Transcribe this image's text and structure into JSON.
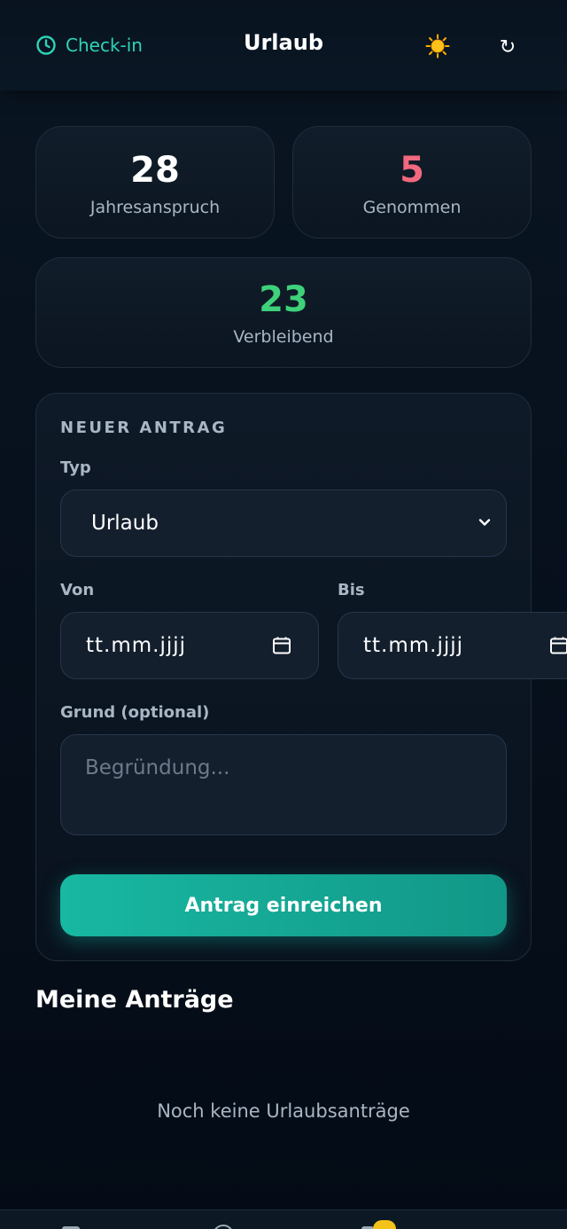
{
  "header": {
    "checkin_label": "Check-in",
    "title": "Urlaub",
    "theme_icon": "sun-icon",
    "refresh_icon": "refresh-icon",
    "refresh_glyph": "↻"
  },
  "stats": {
    "entitlement": {
      "value": "28",
      "label": "Jahresanspruch"
    },
    "taken": {
      "value": "5",
      "label": "Genommen"
    },
    "remaining": {
      "value": "23",
      "label": "Verbleibend"
    }
  },
  "form": {
    "section_title": "NEUER ANTRAG",
    "type_label": "Typ",
    "type_value": "Urlaub",
    "from_label": "Von",
    "from_value": "tt.mm.jjjj",
    "to_label": "Bis",
    "to_value": "tt.mm.jjjj",
    "reason_label": "Grund (optional)",
    "reason_placeholder": "Begründung...",
    "submit_label": "Antrag einreichen"
  },
  "requests": {
    "heading": "Meine Anträge",
    "empty_text": "Noch keine Urlaubsanträge"
  },
  "colors": {
    "accent": "#2ed3b7",
    "taken": "#f2697f",
    "remaining": "#3ed17a",
    "submit": "#17b09c",
    "badge": "#f4c21b"
  }
}
